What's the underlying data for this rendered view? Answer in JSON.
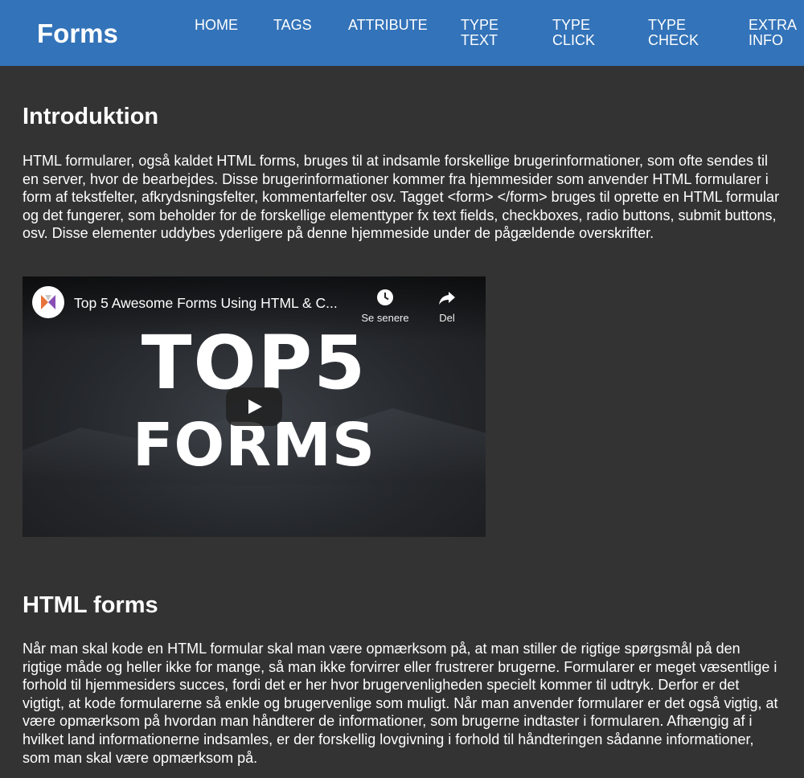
{
  "header": {
    "logo": "Forms",
    "nav": [
      {
        "line1": "HOME",
        "line2": ""
      },
      {
        "line1": "TAGS",
        "line2": ""
      },
      {
        "line1": "ATTRIBUTE",
        "line2": ""
      },
      {
        "line1": "TYPE",
        "line2": "TEXT"
      },
      {
        "line1": "TYPE",
        "line2": "CLICK"
      },
      {
        "line1": "TYPE",
        "line2": "CHECK"
      },
      {
        "line1": "EXTRA",
        "line2": "INFO"
      }
    ]
  },
  "sections": {
    "intro": {
      "heading": "Introduktion",
      "text": "HTML formularer, også kaldet HTML forms, bruges til at indsamle forskellige brugerinformationer, som ofte sendes til en server, hvor de bearbejdes. Disse brugerinformationer kommer fra hjemmesider som anvender HTML formularer i form af tekstfelter, afkrydsningsfelter, kommentarfelter osv. Tagget <form> </form> bruges til oprette en HTML formular og det fungerer, som beholder for de forskellige elementtyper fx text fields, checkboxes, radio buttons, submit buttons, osv. Disse elementer uddybes yderligere på denne hjemmeside under de pågældende overskrifter."
    },
    "video": {
      "title": "Top 5 Awesome Forms Using HTML & C...",
      "watch_later": "Se senere",
      "share": "Del",
      "thumb_line1": "TOP5",
      "thumb_line2": "FORMS"
    },
    "forms": {
      "heading": "HTML forms",
      "text": "Når man skal kode en HTML formular skal man være opmærksom på, at man stiller de rigtige spørgsmål på den rigtige måde og heller ikke for mange, så man ikke forvirrer eller frustrerer brugerne. Formularer er meget væsentlige i forhold til hjemmesiders succes, fordi det er her hvor brugervenligheden specielt kommer til udtryk. Derfor er det vigtigt, at kode formularerne så enkle og brugervenlige som muligt. Når man anvender formularer er det også vigtig, at være opmærksom på hvordan man håndterer de informationer, som brugerne indtaster i formularen. Afhængig af i hvilket land informationerne indsamles, er der forskellig lovgivning i forhold til håndteringen sådanne informationer, som man skal være opmærksom på."
    }
  },
  "colors": {
    "header_bg": "#3373b9",
    "page_bg": "#333333",
    "text": "#ffffff"
  },
  "icons": [
    "clock-icon",
    "share-arrow-icon",
    "play-icon",
    "channel-logo"
  ]
}
